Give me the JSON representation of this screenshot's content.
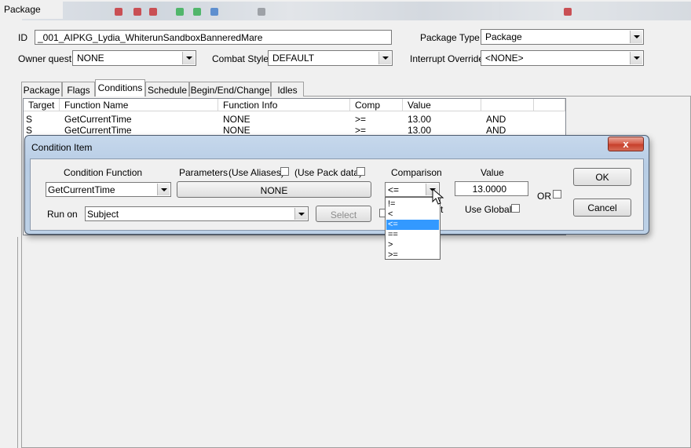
{
  "window": {
    "title": "Package"
  },
  "toolbar": {
    "icons": [
      "red-icon",
      "red-icon",
      "red-icon",
      "green-icon",
      "green-icon",
      "blue-icon",
      "gray-icon"
    ]
  },
  "form": {
    "id_label": "ID",
    "id_value": "_001_AIPKG_Lydia_WhiterunSandboxBanneredMare",
    "package_type_label": "Package Type",
    "package_type_value": "Package",
    "owner_quest_label": "Owner quest",
    "owner_quest_value": "NONE",
    "combat_style_label": "Combat Style",
    "combat_style_value": "DEFAULT",
    "interrupt_override_label": "Interrupt Override",
    "interrupt_override_value": "<NONE>"
  },
  "tabs": [
    {
      "label": "Package"
    },
    {
      "label": "Flags"
    },
    {
      "label": "Conditions"
    },
    {
      "label": "Schedule"
    },
    {
      "label": "Begin/End/Change"
    },
    {
      "label": "Idles"
    }
  ],
  "conditions_table": {
    "columns": [
      "Target",
      "Function Name",
      "Function Info",
      "Comp",
      "Value"
    ],
    "rows": [
      {
        "target": "S",
        "function": "GetCurrentTime",
        "info": "NONE",
        "comp": ">=",
        "value": "13.00",
        "op": "AND"
      },
      {
        "target": "S",
        "function": "GetCurrentTime",
        "info": "NONE",
        "comp": ">=",
        "value": "13.00",
        "op": "AND"
      }
    ]
  },
  "dialog": {
    "title": "Condition Item",
    "close_glyph": "x",
    "condition_function_label": "Condition Function",
    "condition_function_value": "GetCurrentTime",
    "parameters_label": "Parameters",
    "use_aliases_label": "(Use Aliases)",
    "use_pack_data_label": "(Use Pack data)",
    "parameter_button": "NONE",
    "comparison_label": "Comparison",
    "comparison_value": "<=",
    "value_label": "Value",
    "value_value": "13.0000",
    "or_label": "OR",
    "run_on_label": "Run on",
    "run_on_value": "Subject",
    "select_button": "Select",
    "use_global_label": "Use Global",
    "partial_label": "t",
    "ok_button": "OK",
    "cancel_button": "Cancel",
    "comparison_options": [
      "!=",
      "<",
      "<=",
      "==",
      ">",
      ">="
    ],
    "selected_option_index": 2
  },
  "colors": {
    "selection": "#3399ff",
    "close_button": "#c7402c",
    "dialog_frame": "#bcd0e6"
  }
}
